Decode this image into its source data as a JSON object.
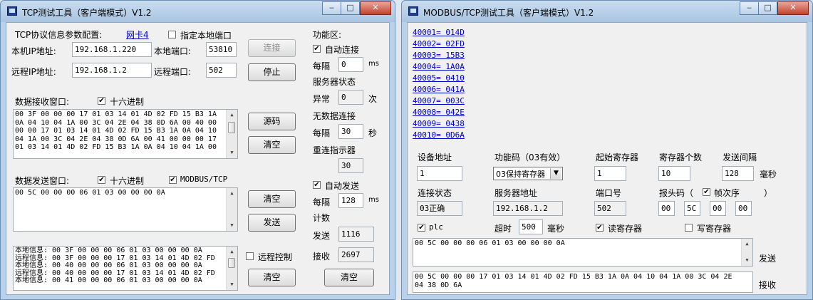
{
  "left": {
    "title": "TCP测试工具（客户端模式）V1.2",
    "params_label": "TCP协议信息参数配置:",
    "nic_link": "网卡4",
    "specify_local_port": "指定本地端口",
    "local_ip_label": "本机IP地址:",
    "local_ip": "192.168.1.220",
    "local_port_label": "本地端口:",
    "local_port": "53810",
    "remote_ip_label": "远程IP地址:",
    "remote_ip": "192.168.1.2",
    "remote_port_label": "远程端口:",
    "remote_port": "502",
    "connect_btn": "连接",
    "stop_btn": "停止",
    "recv_label": "数据接收窗口:",
    "hex_label": "十六进制",
    "recv_text": "00 3F 00 00 00 17 01 03 14 01 4D 02 FD 15 B3 1A\n0A 04 10 04 1A 00 3C 04 2E 04 38 0D 6A 00 40 00\n00 00 17 01 03 14 01 4D 02 FD 15 B3 1A 0A 04 10\n04 1A 00 3C 04 2E 04 38 0D 6A 00 41 00 00 00 17\n01 03 14 01 4D 02 FD 15 B3 1A 0A 04 10 04 1A 00",
    "source_btn": "源码",
    "clear_btn": "清空",
    "send_label": "数据发送窗口:",
    "modbus_tcp_label": "MODBUS/TCP",
    "send_text": "00 5C 00 00 00 06 01 03 00 00 00 0A",
    "send_btn": "发送",
    "log_text": "本地信息: 00 3F 00 00 00 06 01 03 00 00 00 0A\n远程信息: 00 3F 00 00 00 17 01 03 14 01 4D 02 FD\n本地信息: 00 40 00 00 00 06 01 03 00 00 00 0A\n远程信息: 00 40 00 00 00 17 01 03 14 01 4D 02 FD\n本地信息: 00 41 00 00 00 06 01 03 00 00 00 0A",
    "remote_control": "远程控制",
    "func_area": "功能区:",
    "auto_connect": "自动连接",
    "every": "每隔",
    "every1_val": "0",
    "ms_unit": "ms",
    "server_status": "服务器状态",
    "abnormal": "异常",
    "abnormal_val": "0",
    "times_unit": "次",
    "no_data_conn": "无数据连接",
    "every2_val": "30",
    "sec_unit": "秒",
    "reconnect_ind": "重连指示器",
    "reconnect_val": "30",
    "auto_send": "自动发送",
    "every3_val": "128",
    "count_label": "计数",
    "send_count_label": "发送",
    "send_count": "1116",
    "recv_count_label": "接收",
    "recv_count": "2697"
  },
  "right": {
    "title": "MODBUS/TCP测试工具（客户端模式）V1.2",
    "registers": [
      "40001= 014D",
      "40002= 02FD",
      "40003= 15B3",
      "40004= 1A0A",
      "40005= 0410",
      "40006= 041A",
      "40007= 003C",
      "40008= 042E",
      "40009= 0438",
      "40010= 0D6A"
    ],
    "dev_addr_label": "设备地址",
    "dev_addr": "1",
    "func_code_label": "功能码（03有效）",
    "func_code": "03保持寄存器",
    "start_reg_label": "起始寄存器",
    "start_reg": "1",
    "reg_count_label": "寄存器个数",
    "reg_count": "10",
    "send_interval_label": "发送间隔",
    "send_interval": "128",
    "ms_unit": "毫秒",
    "conn_status_label": "连接状态",
    "conn_status": "03正确",
    "server_addr_label": "服务器地址",
    "server_addr": "192.168.1.2",
    "port_label": "端口号",
    "port": "502",
    "header_code_label": "报头码（",
    "frame_seq_label": "帧次序",
    "header_close": "）",
    "header_vals": [
      "00",
      "5C",
      "00",
      "00"
    ],
    "plc_label": "plc",
    "timeout_label": "超时",
    "timeout_val": "500",
    "read_reg_label": "读寄存器",
    "write_reg_label": "写寄存器",
    "send_text": "00 5C 00 00 00 06 01 03 00 00 00 0A",
    "send_label": "发送",
    "recv_text": "00 5C 00 00 00 17 01 03 14 01 4D 02 FD 15 B3 1A 0A 04 10 04 1A 00 3C 04 2E\n04 38 0D 6A",
    "recv_label": "接收"
  }
}
